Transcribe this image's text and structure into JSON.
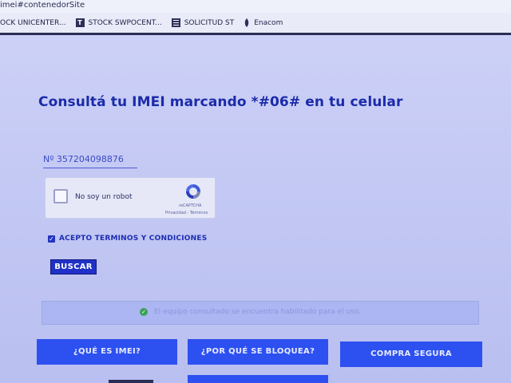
{
  "browser": {
    "url_fragment": "imei#contenedorSite",
    "bookmarks": [
      {
        "label": "OCK UNICENTER...",
        "icon": "none"
      },
      {
        "label": "STOCK SWPOCENT...",
        "icon": "t-icon"
      },
      {
        "label": "SOLICITUD ST",
        "icon": "grid-icon"
      },
      {
        "label": "Enacom",
        "icon": "e-icon"
      }
    ]
  },
  "page": {
    "title": "Consultá tu IMEI marcando *#06# en tu celular",
    "imei_value": "Nº  357204098876"
  },
  "recaptcha": {
    "label": "No soy un robot",
    "brand": "reCAPTCHA",
    "links": "Privacidad - Términos"
  },
  "terms": {
    "label": "ACEPTO TERMINOS Y CONDICIONES",
    "checked": true
  },
  "search": {
    "button_label": "BUSCAR"
  },
  "result": {
    "message": "El equipo consultado se encuentra habilitado para el uso.",
    "status_color": "#3aa15a"
  },
  "nav": {
    "buttons": [
      {
        "label": "¿QUÉ ES IMEI?"
      },
      {
        "label": "¿POR QUÉ SE BLOQUEA?"
      },
      {
        "label": "COMPRA SEGURA"
      }
    ]
  },
  "colors": {
    "accent": "#2d50f0",
    "title": "#1b2ba8"
  }
}
